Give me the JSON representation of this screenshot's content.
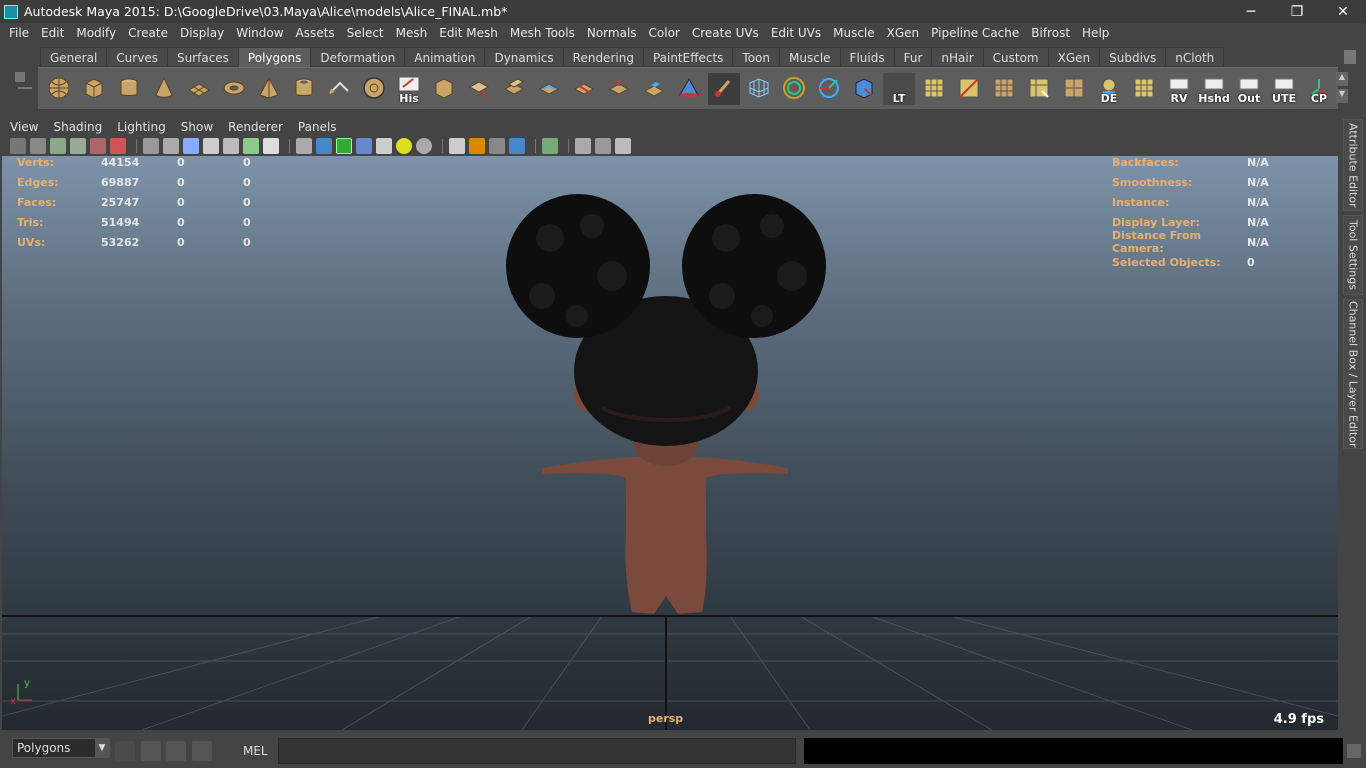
{
  "window": {
    "title": "Autodesk Maya 2015: D:\\GoogleDrive\\03.Maya\\Alice\\models\\Alice_FINAL.mb*",
    "controls": [
      "─",
      "❐",
      "✕"
    ]
  },
  "menubar": [
    "File",
    "Edit",
    "Modify",
    "Create",
    "Display",
    "Window",
    "Assets",
    "Select",
    "Mesh",
    "Edit Mesh",
    "Mesh Tools",
    "Normals",
    "Color",
    "Create UVs",
    "Edit UVs",
    "Muscle",
    "XGen",
    "Pipeline Cache",
    "Bifrost",
    "Help"
  ],
  "shelf_tabs": [
    "General",
    "Curves",
    "Surfaces",
    "Polygons",
    "Deformation",
    "Animation",
    "Dynamics",
    "Rendering",
    "PaintEffects",
    "Toon",
    "Muscle",
    "Fluids",
    "Fur",
    "nHair",
    "Custom",
    "XGen",
    "Subdivs",
    "nCloth"
  ],
  "shelf_active_tab": "Polygons",
  "shelf_labels": {
    "his": "His",
    "lt": "LT",
    "de": "DE",
    "rv": "RV",
    "hshd": "Hshd",
    "out": "Out",
    "ute": "UTE",
    "cp": "CP"
  },
  "panel_menu": [
    "View",
    "Shading",
    "Lighting",
    "Show",
    "Renderer",
    "Panels"
  ],
  "hud_left": [
    {
      "label": "Verts:",
      "v1": "44154",
      "v2": "0",
      "v3": "0"
    },
    {
      "label": "Edges:",
      "v1": "69887",
      "v2": "0",
      "v3": "0"
    },
    {
      "label": "Faces:",
      "v1": "25747",
      "v2": "0",
      "v3": "0"
    },
    {
      "label": "Tris:",
      "v1": "51494",
      "v2": "0",
      "v3": "0"
    },
    {
      "label": "UVs:",
      "v1": "53262",
      "v2": "0",
      "v3": "0"
    }
  ],
  "hud_right": [
    {
      "label": "Backfaces:",
      "value": "N/A"
    },
    {
      "label": "Smoothness:",
      "value": "N/A"
    },
    {
      "label": "Instance:",
      "value": "N/A"
    },
    {
      "label": "Display Layer:",
      "value": "N/A"
    },
    {
      "label": "Distance From Camera:",
      "value": "N/A"
    },
    {
      "label": "Selected Objects:",
      "value": "0"
    }
  ],
  "viewport": {
    "camera": "persp",
    "fps": "4.9 fps",
    "axis_y": "y",
    "axis_x": "x"
  },
  "side_tabs": [
    "Attribute Editor",
    "Tool Settings",
    "Channel Box / Layer Editor"
  ],
  "cmdbar": {
    "menu_set": "Polygons",
    "lang": "MEL"
  }
}
